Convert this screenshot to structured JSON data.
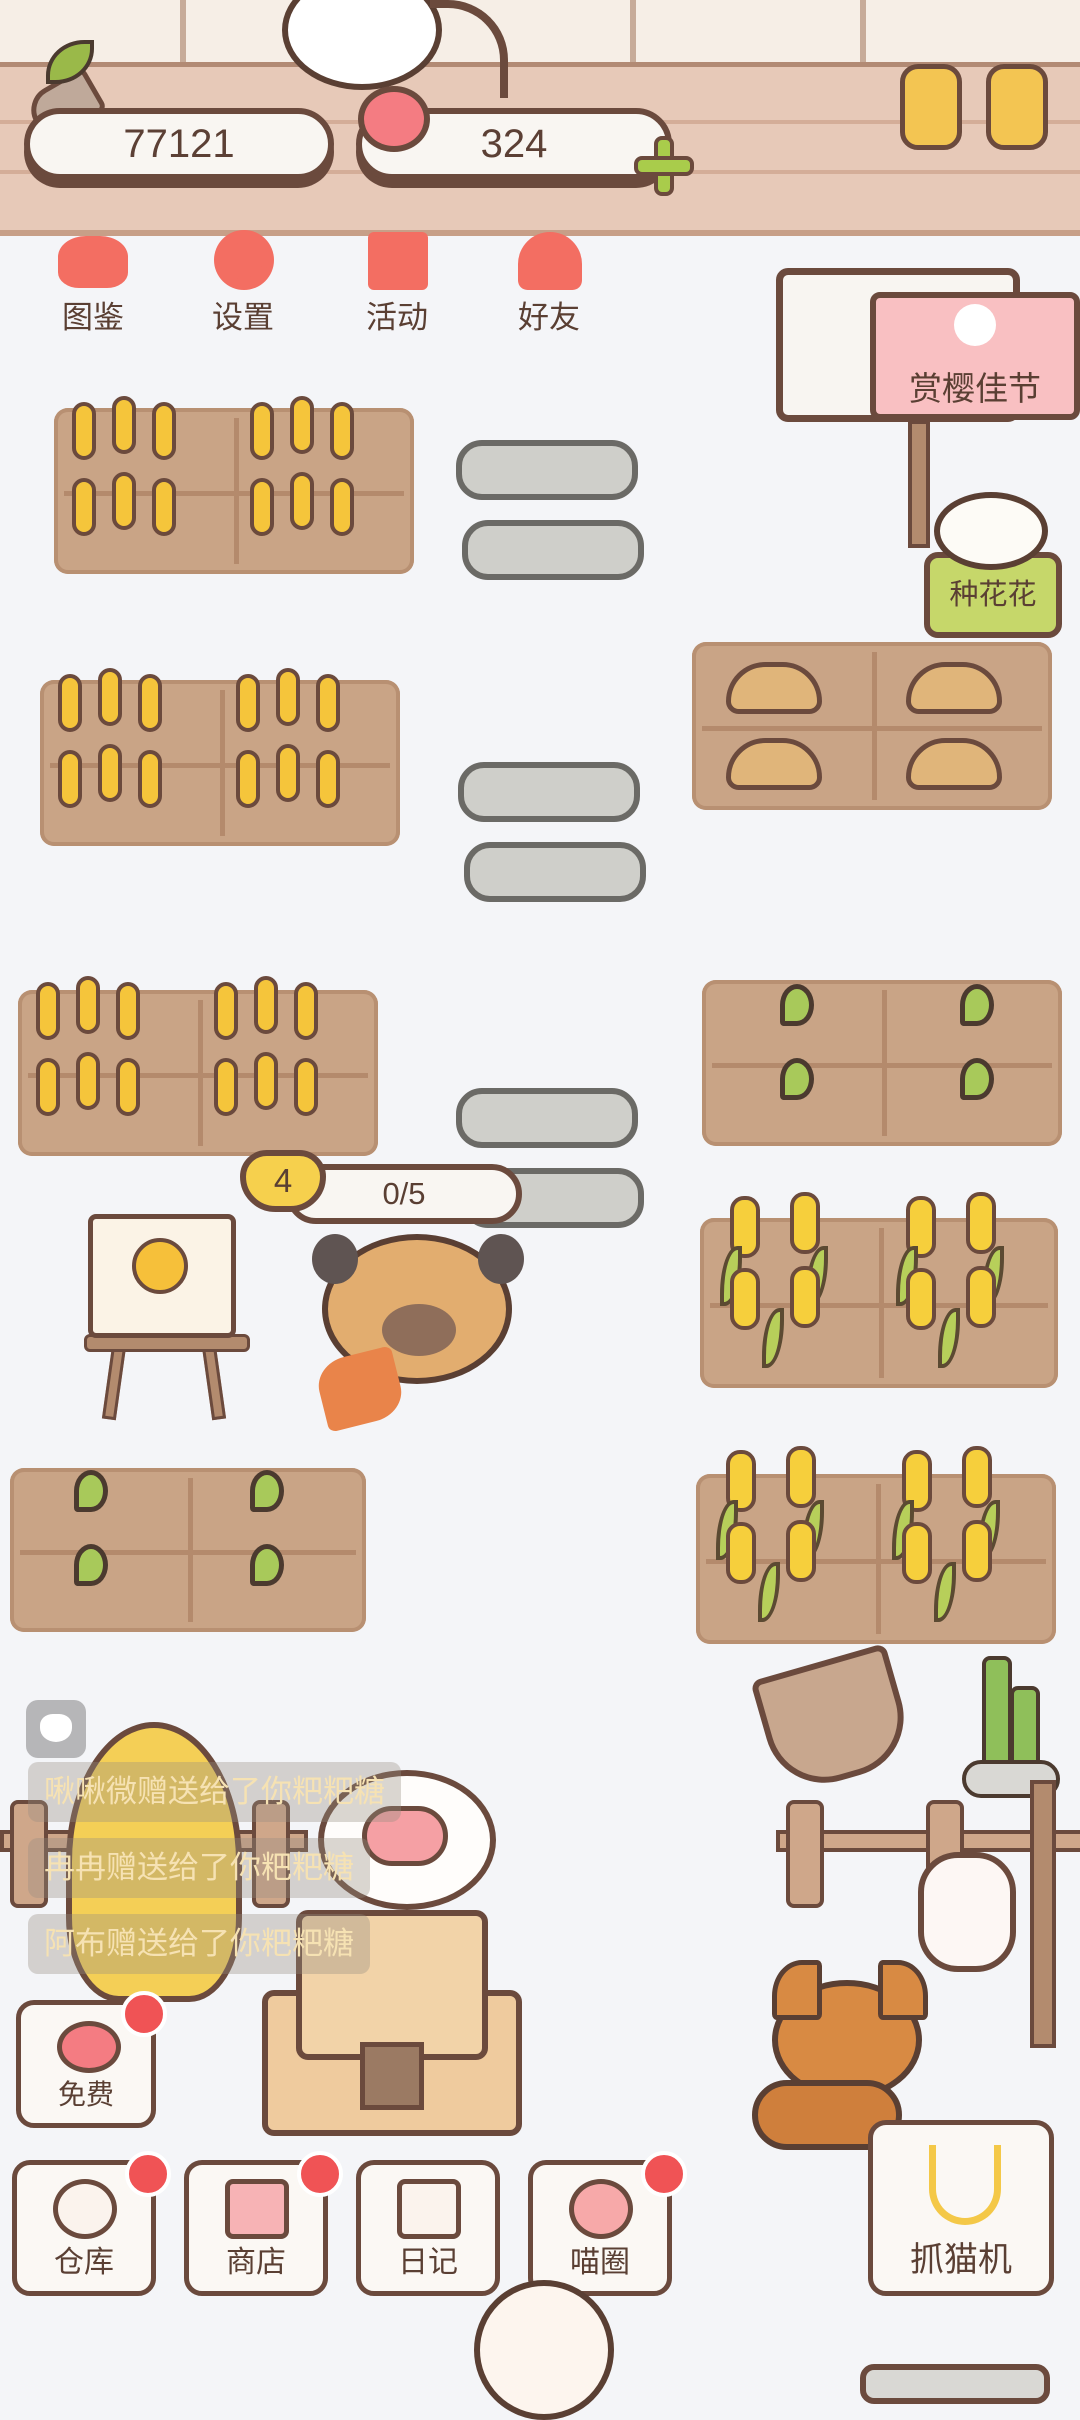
{
  "currency": {
    "coins": "77121",
    "hearts": "324"
  },
  "top_menu": [
    {
      "label": "图鉴",
      "icon": "cat-book-icon"
    },
    {
      "label": "设置",
      "icon": "gear-icon"
    },
    {
      "label": "活动",
      "icon": "gift-icon"
    },
    {
      "label": "好友",
      "icon": "friends-icon"
    }
  ],
  "event_sign": {
    "label": "赏樱佳节"
  },
  "flower_sign": {
    "label": "种花花"
  },
  "pet_status": {
    "level": "4",
    "progress": "0/5",
    "progress_fraction": 0
  },
  "messages": [
    "啾啾微赠送给了你粑粑糖",
    "冉冉赠送给了你粑粑糖",
    "阿布赠送给了你粑粑糖"
  ],
  "free_button": {
    "label": "免费"
  },
  "bottom_bar": [
    {
      "label": "仓库",
      "icon": "storage-icon"
    },
    {
      "label": "商店",
      "icon": "shop-icon"
    },
    {
      "label": "日记",
      "icon": "diary-icon"
    },
    {
      "label": "喵圈",
      "icon": "planet-cat-icon"
    }
  ],
  "claw_machine": {
    "label": "抓猫机"
  },
  "colors": {
    "accent_red": "#f05355",
    "soil": "#c9a486",
    "outline": "#6b4a3d",
    "wheat": "#f5c53b",
    "leaf_green": "#a8c95a",
    "sign_pink": "#f7b8b8",
    "sign_green": "#c6d76a"
  }
}
